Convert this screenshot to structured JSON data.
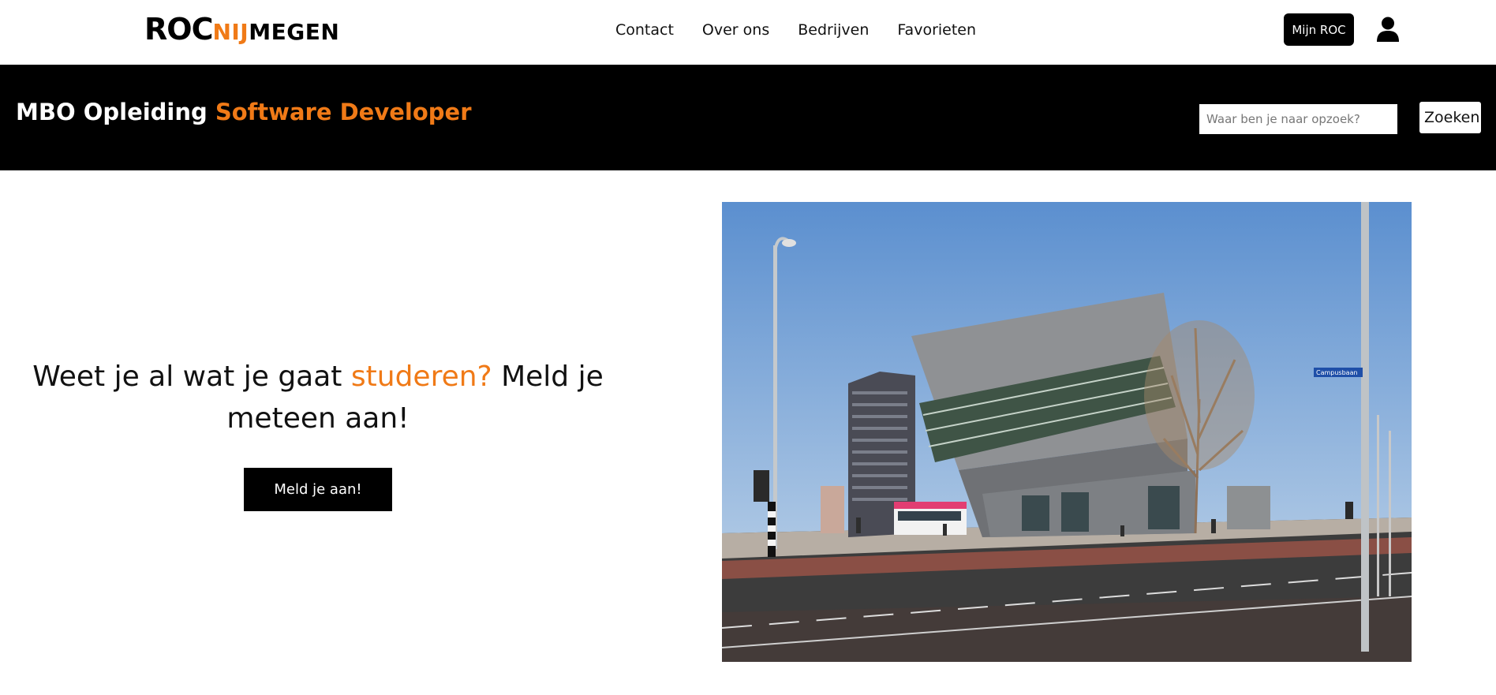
{
  "header": {
    "logo": {
      "part1": "ROC",
      "part2": "NIJ",
      "part3": "MEGEN"
    },
    "nav": [
      "Contact",
      "Over ons",
      "Bedrijven",
      "Favorieten"
    ],
    "mijn_roc_label": "Mijn ROC",
    "user_icon": "user-icon"
  },
  "banner": {
    "title_prefix": "MBO Opleiding ",
    "title_highlight": "Software Developer",
    "search_placeholder": "Waar ben je naar opzoek?",
    "search_button": "Zoeken"
  },
  "hero": {
    "text_before": "Weet je al wat je gaat ",
    "text_highlight": "studeren?",
    "text_after": " Meld je meteen aan!",
    "cta_label": "Meld je aan!",
    "image_street_sign": "Campusbaan"
  },
  "colors": {
    "accent": "#f07a17",
    "banner_bg": "#000000"
  }
}
